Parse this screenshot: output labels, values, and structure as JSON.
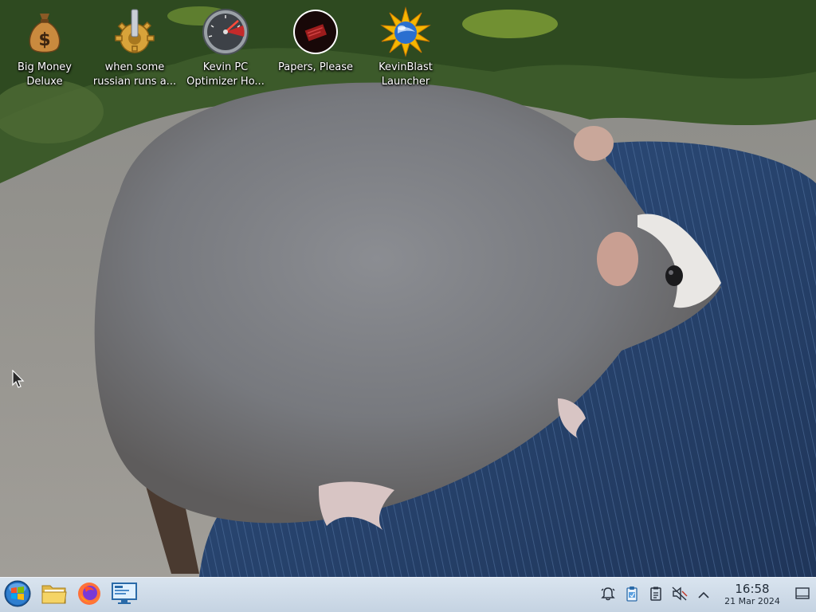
{
  "desktop": {
    "icons": [
      {
        "label": "Big Money\nDeluxe",
        "icon": "money-bag-icon"
      },
      {
        "label": "when some\nrussian runs a...",
        "icon": "gear-icon"
      },
      {
        "label": "Kevin PC\nOptimizer Ho...",
        "icon": "speedometer-icon"
      },
      {
        "label": "Papers, Please",
        "icon": "papers-please-icon"
      },
      {
        "label": "KevinBlast\nLauncher",
        "icon": "starburst-globe-icon"
      }
    ]
  },
  "taskbar": {
    "pinned": [
      {
        "name": "start-menu",
        "icon": "windows-orb-icon"
      },
      {
        "name": "file-manager",
        "icon": "folder-icon"
      },
      {
        "name": "firefox",
        "icon": "firefox-icon"
      },
      {
        "name": "control-panel",
        "icon": "display-settings-icon"
      }
    ],
    "tray": [
      {
        "name": "notifications",
        "icon": "bell-icon"
      },
      {
        "name": "updates",
        "icon": "clipboard-icon"
      },
      {
        "name": "clipboard",
        "icon": "clipboard-list-icon"
      },
      {
        "name": "volume",
        "icon": "speaker-muted-icon"
      },
      {
        "name": "show-hidden",
        "icon": "chevron-up-icon"
      }
    ],
    "clock": {
      "time": "16:58",
      "date": "21 Mar 2024"
    }
  },
  "colors": {
    "taskbar_top": "#d9e4ef",
    "taskbar_bottom": "#c5d3e2",
    "label_text": "#ffffff"
  }
}
